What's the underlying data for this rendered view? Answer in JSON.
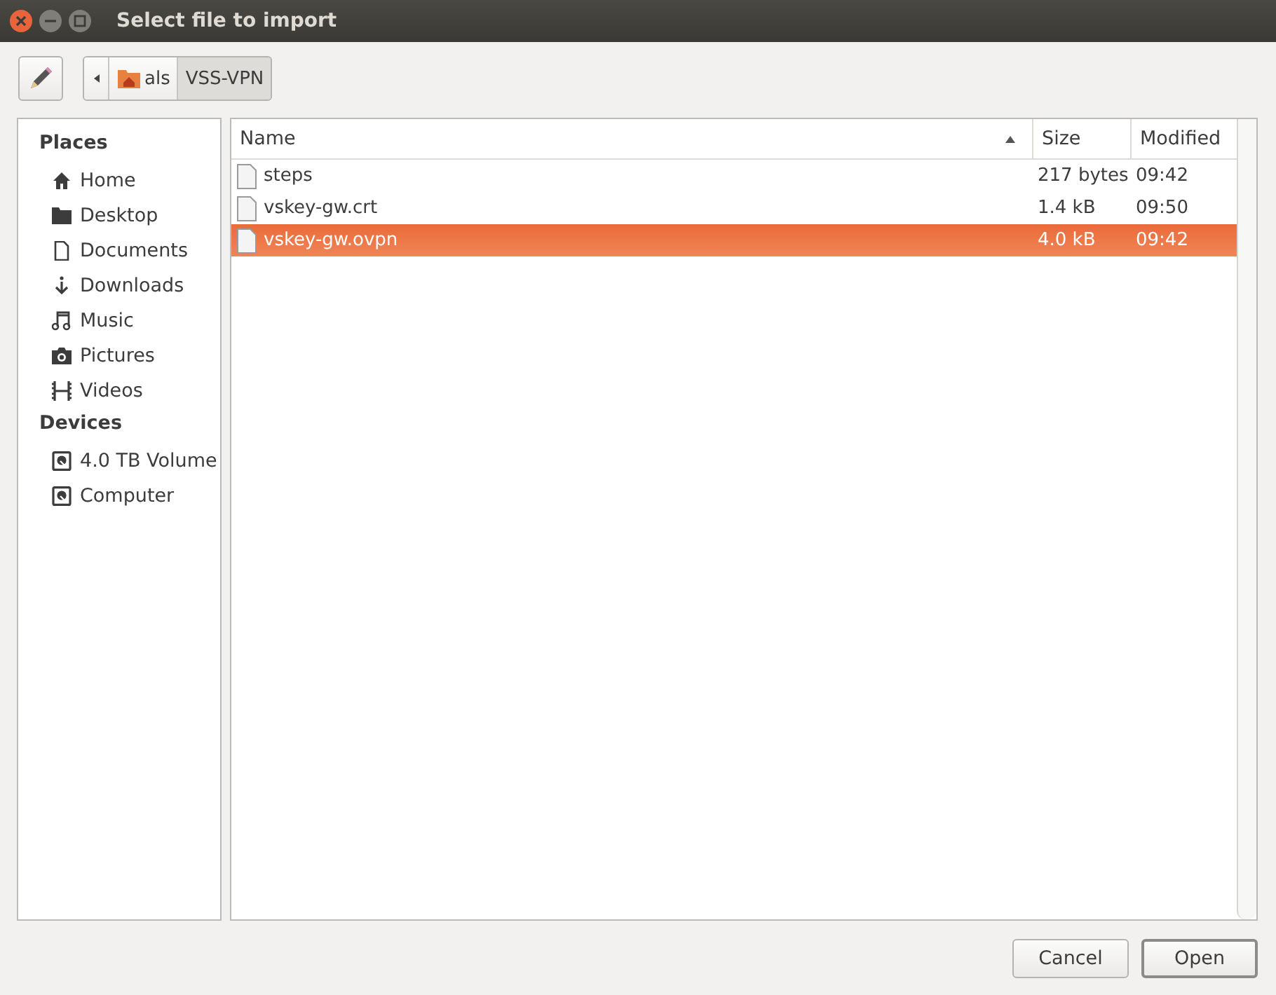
{
  "window": {
    "title": "Select file to import"
  },
  "path": [
    {
      "label": "als",
      "selected": false
    },
    {
      "label": "VSS-VPN",
      "selected": true
    }
  ],
  "sidebar": [
    {
      "heading": "Places",
      "items": [
        {
          "label": "Home",
          "kind": "home"
        },
        {
          "label": "Desktop",
          "kind": "folder"
        },
        {
          "label": "Documents",
          "kind": "document"
        },
        {
          "label": "Downloads",
          "kind": "download"
        },
        {
          "label": "Music",
          "kind": "music"
        },
        {
          "label": "Pictures",
          "kind": "camera"
        },
        {
          "label": "Videos",
          "kind": "film"
        }
      ]
    },
    {
      "heading": "Devices",
      "items": [
        {
          "label": "4.0 TB Volume",
          "kind": "drive"
        },
        {
          "label": "Computer",
          "kind": "drive"
        }
      ]
    }
  ],
  "table": {
    "columns": [
      "Name",
      "Size",
      "Modified"
    ],
    "rows": [
      {
        "name": "steps",
        "size": "217 bytes",
        "modified": "09:42",
        "selected": false
      },
      {
        "name": "vskey-gw.crt",
        "size": "1.4 kB",
        "modified": "09:50",
        "selected": false
      },
      {
        "name": "vskey-gw.ovpn",
        "size": "4.0 kB",
        "modified": "09:42",
        "selected": true
      }
    ]
  },
  "buttons": [
    "Cancel",
    "Open"
  ]
}
